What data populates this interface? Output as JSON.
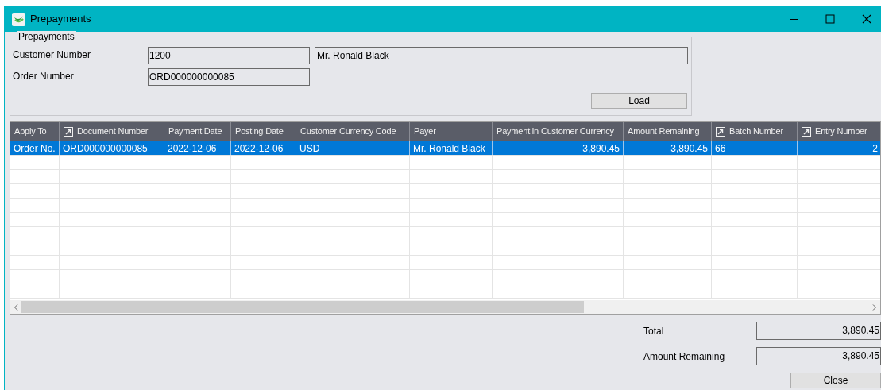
{
  "window": {
    "title": "Prepayments"
  },
  "group": {
    "title": "Prepayments",
    "fields": [
      {
        "label": "Customer Number",
        "value": "1200",
        "extra_value": "Mr. Ronald Black"
      },
      {
        "label": "Order Number",
        "value": "ORD000000000085"
      }
    ],
    "load_button": "Load"
  },
  "table": {
    "columns": [
      {
        "label": "Apply To",
        "icon": false
      },
      {
        "label": "Document Number",
        "icon": true
      },
      {
        "label": "Payment Date",
        "icon": false
      },
      {
        "label": "Posting Date",
        "icon": false
      },
      {
        "label": "Customer Currency Code",
        "icon": false
      },
      {
        "label": "Payer",
        "icon": false
      },
      {
        "label": "Payment in Customer Currency",
        "icon": false
      },
      {
        "label": "Amount Remaining",
        "icon": false
      },
      {
        "label": "Batch Number",
        "icon": true
      },
      {
        "label": "Entry Number",
        "icon": true
      }
    ],
    "rows": [
      {
        "selected": true,
        "cells": [
          "Order No.",
          "ORD000000000085",
          "2022-12-06",
          "2022-12-06",
          "USD",
          "Mr. Ronald Black",
          "3,890.45",
          "3,890.45",
          "66",
          "2"
        ]
      }
    ]
  },
  "totals": [
    {
      "label": "Total",
      "value": "3,890.45"
    },
    {
      "label": "Amount Remaining",
      "value": "3,890.45"
    }
  ],
  "close_button": "Close"
}
